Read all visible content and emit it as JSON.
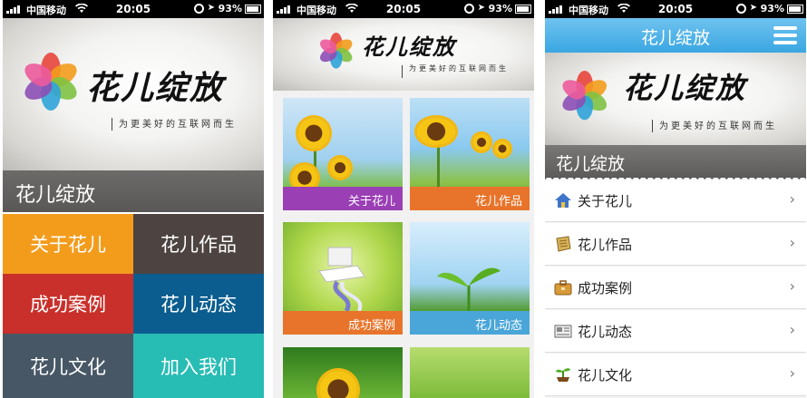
{
  "status_bar": {
    "carrier": "中国移动",
    "time": "20:05",
    "battery": "93%",
    "battery_level": 0.93
  },
  "brand": {
    "calligraphy": "花儿绽放",
    "slogan": "为更美好的互联网而生"
  },
  "screen1": {
    "title": "花儿绽放",
    "tiles": [
      {
        "label": "关于花儿",
        "color": "#f39c1c"
      },
      {
        "label": "花儿作品",
        "color": "#4d4442"
      },
      {
        "label": "成功案例",
        "color": "#c9302b"
      },
      {
        "label": "花儿动态",
        "color": "#0b5d8f"
      },
      {
        "label": "花儿文化",
        "color": "#475765"
      },
      {
        "label": "加入我们",
        "color": "#27bcb4"
      }
    ]
  },
  "screen2": {
    "cards": [
      {
        "caption": "关于花儿",
        "caption_color": "#9b3fb5"
      },
      {
        "caption": "花儿作品",
        "caption_color": "#e8742b"
      },
      {
        "caption": "成功案例",
        "caption_color": "#e8742b"
      },
      {
        "caption": "花儿动态",
        "caption_color": "#4aa6d9"
      }
    ]
  },
  "screen3": {
    "header_title": "花儿绽放",
    "section_title": "花儿绽放",
    "menu": [
      {
        "label": "关于花儿",
        "icon": "house-icon"
      },
      {
        "label": "花儿作品",
        "icon": "scroll-icon"
      },
      {
        "label": "成功案例",
        "icon": "briefcase-icon"
      },
      {
        "label": "花儿动态",
        "icon": "newspaper-icon"
      },
      {
        "label": "花儿文化",
        "icon": "plant-icon"
      }
    ],
    "chevron": "›"
  }
}
